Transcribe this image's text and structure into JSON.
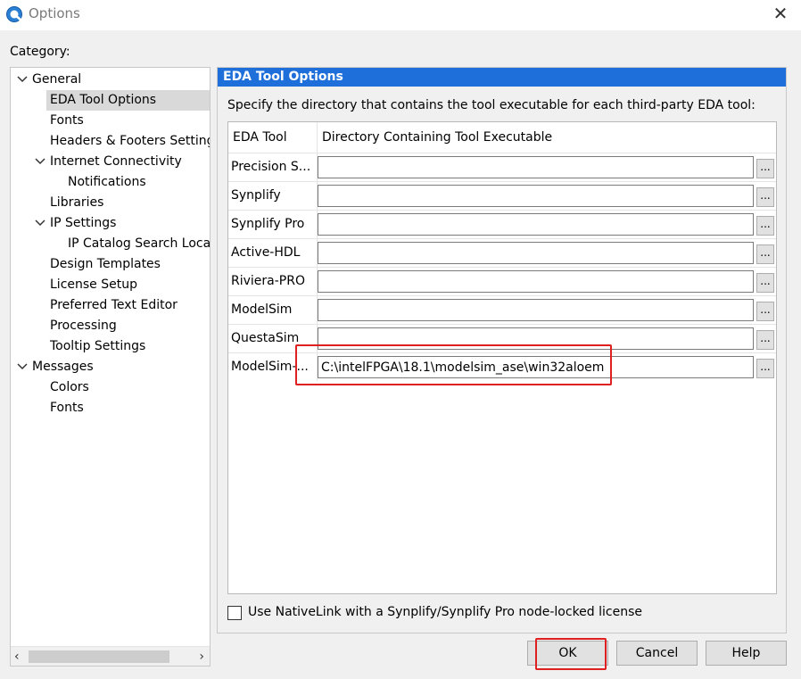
{
  "window": {
    "title": "Options",
    "close_glyph": "✕"
  },
  "category_label": "Category:",
  "tree": [
    {
      "label": "General",
      "level": 0,
      "expanded": true
    },
    {
      "label": "EDA Tool Options",
      "level": 1,
      "selected": true
    },
    {
      "label": "Fonts",
      "level": 1
    },
    {
      "label": "Headers & Footers Setting",
      "level": 1
    },
    {
      "label": "Internet Connectivity",
      "level": 1,
      "expanded": true
    },
    {
      "label": "Notifications",
      "level": 2
    },
    {
      "label": "Libraries",
      "level": 1
    },
    {
      "label": "IP Settings",
      "level": 1,
      "expanded": true
    },
    {
      "label": "IP Catalog Search Locat",
      "level": 2
    },
    {
      "label": "Design Templates",
      "level": 1
    },
    {
      "label": "License Setup",
      "level": 1
    },
    {
      "label": "Preferred Text Editor",
      "level": 1
    },
    {
      "label": "Processing",
      "level": 1
    },
    {
      "label": "Tooltip Settings",
      "level": 1
    },
    {
      "label": "Messages",
      "level": 0,
      "expanded": true
    },
    {
      "label": "Colors",
      "level": 1
    },
    {
      "label": "Fonts",
      "level": 1
    }
  ],
  "panel": {
    "title": "EDA Tool Options",
    "description": "Specify the directory that contains the tool executable for each third-party EDA tool:",
    "columns": [
      "EDA Tool",
      "Directory Containing Tool Executable"
    ],
    "rows": [
      {
        "tool": "Precision S...",
        "path": ""
      },
      {
        "tool": "Synplify",
        "path": ""
      },
      {
        "tool": "Synplify Pro",
        "path": ""
      },
      {
        "tool": "Active-HDL",
        "path": ""
      },
      {
        "tool": "Riviera-PRO",
        "path": ""
      },
      {
        "tool": "ModelSim",
        "path": ""
      },
      {
        "tool": "QuestaSim",
        "path": ""
      },
      {
        "tool": "ModelSim-...",
        "path": "C:\\intelFPGA\\18.1\\modelsim_ase\\win32aloem"
      }
    ],
    "browse_label": "...",
    "nativelink_label": "Use NativeLink with a Synplify/Synplify Pro node-locked license",
    "nativelink_checked": false
  },
  "buttons": {
    "ok": "OK",
    "cancel": "Cancel",
    "help": "Help"
  },
  "colors": {
    "header_blue": "#1e6fd9",
    "highlight_red": "#e02020"
  }
}
